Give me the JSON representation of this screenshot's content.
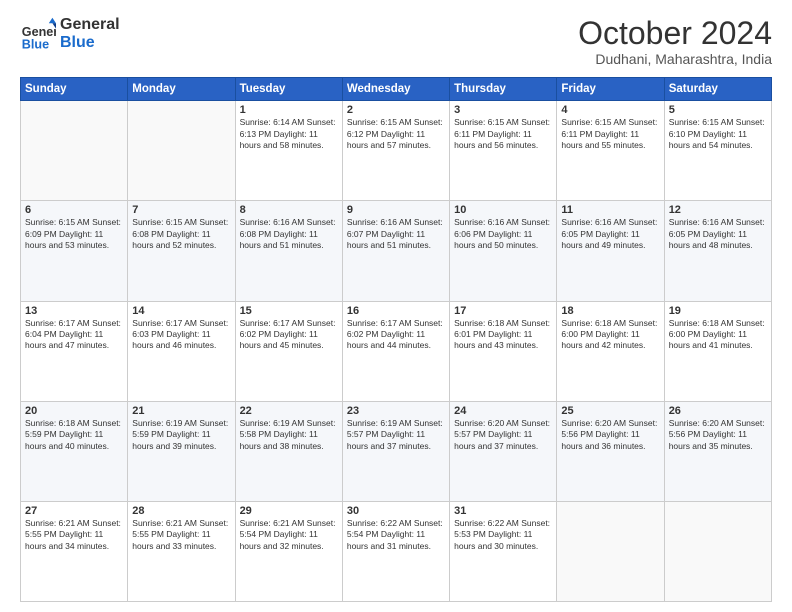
{
  "logo": {
    "line1": "General",
    "line2": "Blue"
  },
  "header": {
    "month": "October 2024",
    "location": "Dudhani, Maharashtra, India"
  },
  "weekdays": [
    "Sunday",
    "Monday",
    "Tuesday",
    "Wednesday",
    "Thursday",
    "Friday",
    "Saturday"
  ],
  "weeks": [
    [
      {
        "day": "",
        "info": ""
      },
      {
        "day": "",
        "info": ""
      },
      {
        "day": "1",
        "info": "Sunrise: 6:14 AM\nSunset: 6:13 PM\nDaylight: 11 hours and 58 minutes."
      },
      {
        "day": "2",
        "info": "Sunrise: 6:15 AM\nSunset: 6:12 PM\nDaylight: 11 hours and 57 minutes."
      },
      {
        "day": "3",
        "info": "Sunrise: 6:15 AM\nSunset: 6:11 PM\nDaylight: 11 hours and 56 minutes."
      },
      {
        "day": "4",
        "info": "Sunrise: 6:15 AM\nSunset: 6:11 PM\nDaylight: 11 hours and 55 minutes."
      },
      {
        "day": "5",
        "info": "Sunrise: 6:15 AM\nSunset: 6:10 PM\nDaylight: 11 hours and 54 minutes."
      }
    ],
    [
      {
        "day": "6",
        "info": "Sunrise: 6:15 AM\nSunset: 6:09 PM\nDaylight: 11 hours and 53 minutes."
      },
      {
        "day": "7",
        "info": "Sunrise: 6:15 AM\nSunset: 6:08 PM\nDaylight: 11 hours and 52 minutes."
      },
      {
        "day": "8",
        "info": "Sunrise: 6:16 AM\nSunset: 6:08 PM\nDaylight: 11 hours and 51 minutes."
      },
      {
        "day": "9",
        "info": "Sunrise: 6:16 AM\nSunset: 6:07 PM\nDaylight: 11 hours and 51 minutes."
      },
      {
        "day": "10",
        "info": "Sunrise: 6:16 AM\nSunset: 6:06 PM\nDaylight: 11 hours and 50 minutes."
      },
      {
        "day": "11",
        "info": "Sunrise: 6:16 AM\nSunset: 6:05 PM\nDaylight: 11 hours and 49 minutes."
      },
      {
        "day": "12",
        "info": "Sunrise: 6:16 AM\nSunset: 6:05 PM\nDaylight: 11 hours and 48 minutes."
      }
    ],
    [
      {
        "day": "13",
        "info": "Sunrise: 6:17 AM\nSunset: 6:04 PM\nDaylight: 11 hours and 47 minutes."
      },
      {
        "day": "14",
        "info": "Sunrise: 6:17 AM\nSunset: 6:03 PM\nDaylight: 11 hours and 46 minutes."
      },
      {
        "day": "15",
        "info": "Sunrise: 6:17 AM\nSunset: 6:02 PM\nDaylight: 11 hours and 45 minutes."
      },
      {
        "day": "16",
        "info": "Sunrise: 6:17 AM\nSunset: 6:02 PM\nDaylight: 11 hours and 44 minutes."
      },
      {
        "day": "17",
        "info": "Sunrise: 6:18 AM\nSunset: 6:01 PM\nDaylight: 11 hours and 43 minutes."
      },
      {
        "day": "18",
        "info": "Sunrise: 6:18 AM\nSunset: 6:00 PM\nDaylight: 11 hours and 42 minutes."
      },
      {
        "day": "19",
        "info": "Sunrise: 6:18 AM\nSunset: 6:00 PM\nDaylight: 11 hours and 41 minutes."
      }
    ],
    [
      {
        "day": "20",
        "info": "Sunrise: 6:18 AM\nSunset: 5:59 PM\nDaylight: 11 hours and 40 minutes."
      },
      {
        "day": "21",
        "info": "Sunrise: 6:19 AM\nSunset: 5:59 PM\nDaylight: 11 hours and 39 minutes."
      },
      {
        "day": "22",
        "info": "Sunrise: 6:19 AM\nSunset: 5:58 PM\nDaylight: 11 hours and 38 minutes."
      },
      {
        "day": "23",
        "info": "Sunrise: 6:19 AM\nSunset: 5:57 PM\nDaylight: 11 hours and 37 minutes."
      },
      {
        "day": "24",
        "info": "Sunrise: 6:20 AM\nSunset: 5:57 PM\nDaylight: 11 hours and 37 minutes."
      },
      {
        "day": "25",
        "info": "Sunrise: 6:20 AM\nSunset: 5:56 PM\nDaylight: 11 hours and 36 minutes."
      },
      {
        "day": "26",
        "info": "Sunrise: 6:20 AM\nSunset: 5:56 PM\nDaylight: 11 hours and 35 minutes."
      }
    ],
    [
      {
        "day": "27",
        "info": "Sunrise: 6:21 AM\nSunset: 5:55 PM\nDaylight: 11 hours and 34 minutes."
      },
      {
        "day": "28",
        "info": "Sunrise: 6:21 AM\nSunset: 5:55 PM\nDaylight: 11 hours and 33 minutes."
      },
      {
        "day": "29",
        "info": "Sunrise: 6:21 AM\nSunset: 5:54 PM\nDaylight: 11 hours and 32 minutes."
      },
      {
        "day": "30",
        "info": "Sunrise: 6:22 AM\nSunset: 5:54 PM\nDaylight: 11 hours and 31 minutes."
      },
      {
        "day": "31",
        "info": "Sunrise: 6:22 AM\nSunset: 5:53 PM\nDaylight: 11 hours and 30 minutes."
      },
      {
        "day": "",
        "info": ""
      },
      {
        "day": "",
        "info": ""
      }
    ]
  ]
}
